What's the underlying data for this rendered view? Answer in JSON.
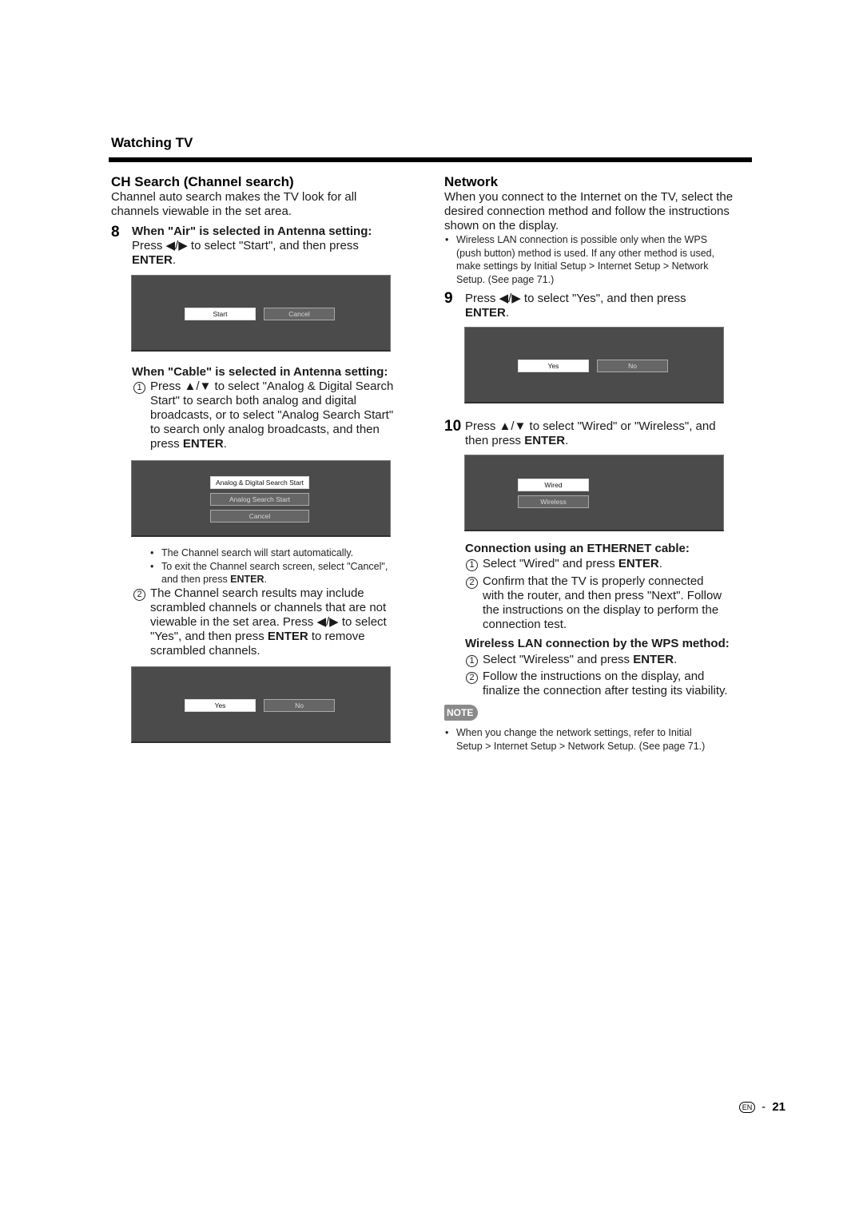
{
  "header": {
    "section_title": "Watching TV"
  },
  "left": {
    "title": "CH Search (Channel search)",
    "intro": [
      "Channel auto search makes the TV look for all",
      "channels viewable in the set area."
    ],
    "step8": {
      "number": "8",
      "heading": "When \"Air\" is selected in Antenna setting:",
      "line1": "Press ◀/▶ to select \"Start\", and then press",
      "enter": "ENTER",
      "period": "."
    },
    "screen_air": {
      "buttons": [
        {
          "label": "Start",
          "selected": true
        },
        {
          "label": "Cancel",
          "selected": false
        }
      ]
    },
    "cable": {
      "heading": "When \"Cable\" is selected in Antenna setting:",
      "item1_marker": "1",
      "item1_lines": [
        "Press ▲/▼ to select \"Analog & Digital Search",
        "Start\" to search both analog and digital",
        "broadcasts, or to select \"Analog Search Start\"",
        "to search only analog broadcasts, and then"
      ],
      "item1_last_prefix": "press ",
      "enter": "ENTER",
      "period": "."
    },
    "screen_cable": {
      "buttons": [
        {
          "label": "Analog & Digital Search Start",
          "selected": true
        },
        {
          "label": "Analog Search Start",
          "selected": false
        },
        {
          "label": "Cancel",
          "selected": false
        }
      ]
    },
    "bullets": {
      "b1": "The Channel search will start automatically.",
      "b2_line1": "To exit the Channel search screen, select \"Cancel\",",
      "b2_line2_prefix": "and then press ",
      "enter": "ENTER",
      "period": "."
    },
    "item2": {
      "marker": "2",
      "lines": [
        "The Channel search results may include",
        "scrambled channels or channels that are not",
        "viewable in the set area. Press ◀/▶ to select"
      ],
      "line4_prefix": "\"Yes\", and then press ",
      "enter": "ENTER",
      "line4_suffix": " to remove",
      "line5": "scrambled channels."
    },
    "screen_scrambled": {
      "buttons": [
        {
          "label": "Yes",
          "selected": true
        },
        {
          "label": "No",
          "selected": false
        }
      ]
    }
  },
  "right": {
    "title": "Network",
    "intro": [
      "When you connect to the Internet on the TV, select the",
      "desired connection method and follow the instructions",
      "shown on the display."
    ],
    "bullet_lines": [
      "Wireless LAN connection is possible only when the WPS",
      "(push button) method is used. If any other method is used,",
      "make settings by Initial Setup > Internet Setup > Network",
      "Setup. (See page 71.)"
    ],
    "step9": {
      "number": "9",
      "line1": "Press ◀/▶ to select \"Yes\", and then press",
      "enter": "ENTER",
      "period": "."
    },
    "screen_yes": {
      "buttons": [
        {
          "label": "Yes",
          "selected": true
        },
        {
          "label": "No",
          "selected": false
        }
      ]
    },
    "step10": {
      "number": "10",
      "line1": "Press ▲/▼ to select \"Wired\" or \"Wireless\", and",
      "line2_prefix": "then press ",
      "enter": "ENTER",
      "period": "."
    },
    "screen_conn": {
      "buttons": [
        {
          "label": "Wired",
          "selected": true
        },
        {
          "label": "Wireless",
          "selected": false
        }
      ]
    },
    "ethernet": {
      "heading": "Connection using an ETHERNET cable:",
      "i1_marker": "1",
      "i1_prefix": "Select \"Wired\" and press ",
      "enter": "ENTER",
      "period": ".",
      "i2_marker": "2",
      "i2_lines": [
        "Confirm that the TV is properly connected",
        "with the router, and then press \"Next\". Follow",
        "the instructions on the display to perform the",
        "connection test."
      ]
    },
    "wps": {
      "heading": "Wireless LAN connection by the WPS method:",
      "i1_marker": "1",
      "i1_prefix": "Select \"Wireless\" and press ",
      "enter": "ENTER",
      "period": ".",
      "i2_marker": "2",
      "i2_lines": [
        "Follow the instructions on the display, and",
        "finalize the connection after testing its viability."
      ]
    },
    "note": {
      "badge": "NOTE",
      "lines": [
        "When you change the network settings, refer to Initial",
        "Setup > Internet Setup > Network Setup. (See page 71.)"
      ]
    }
  },
  "footer": {
    "lang_icon": "EN",
    "separator": "-",
    "page_number": "21"
  }
}
